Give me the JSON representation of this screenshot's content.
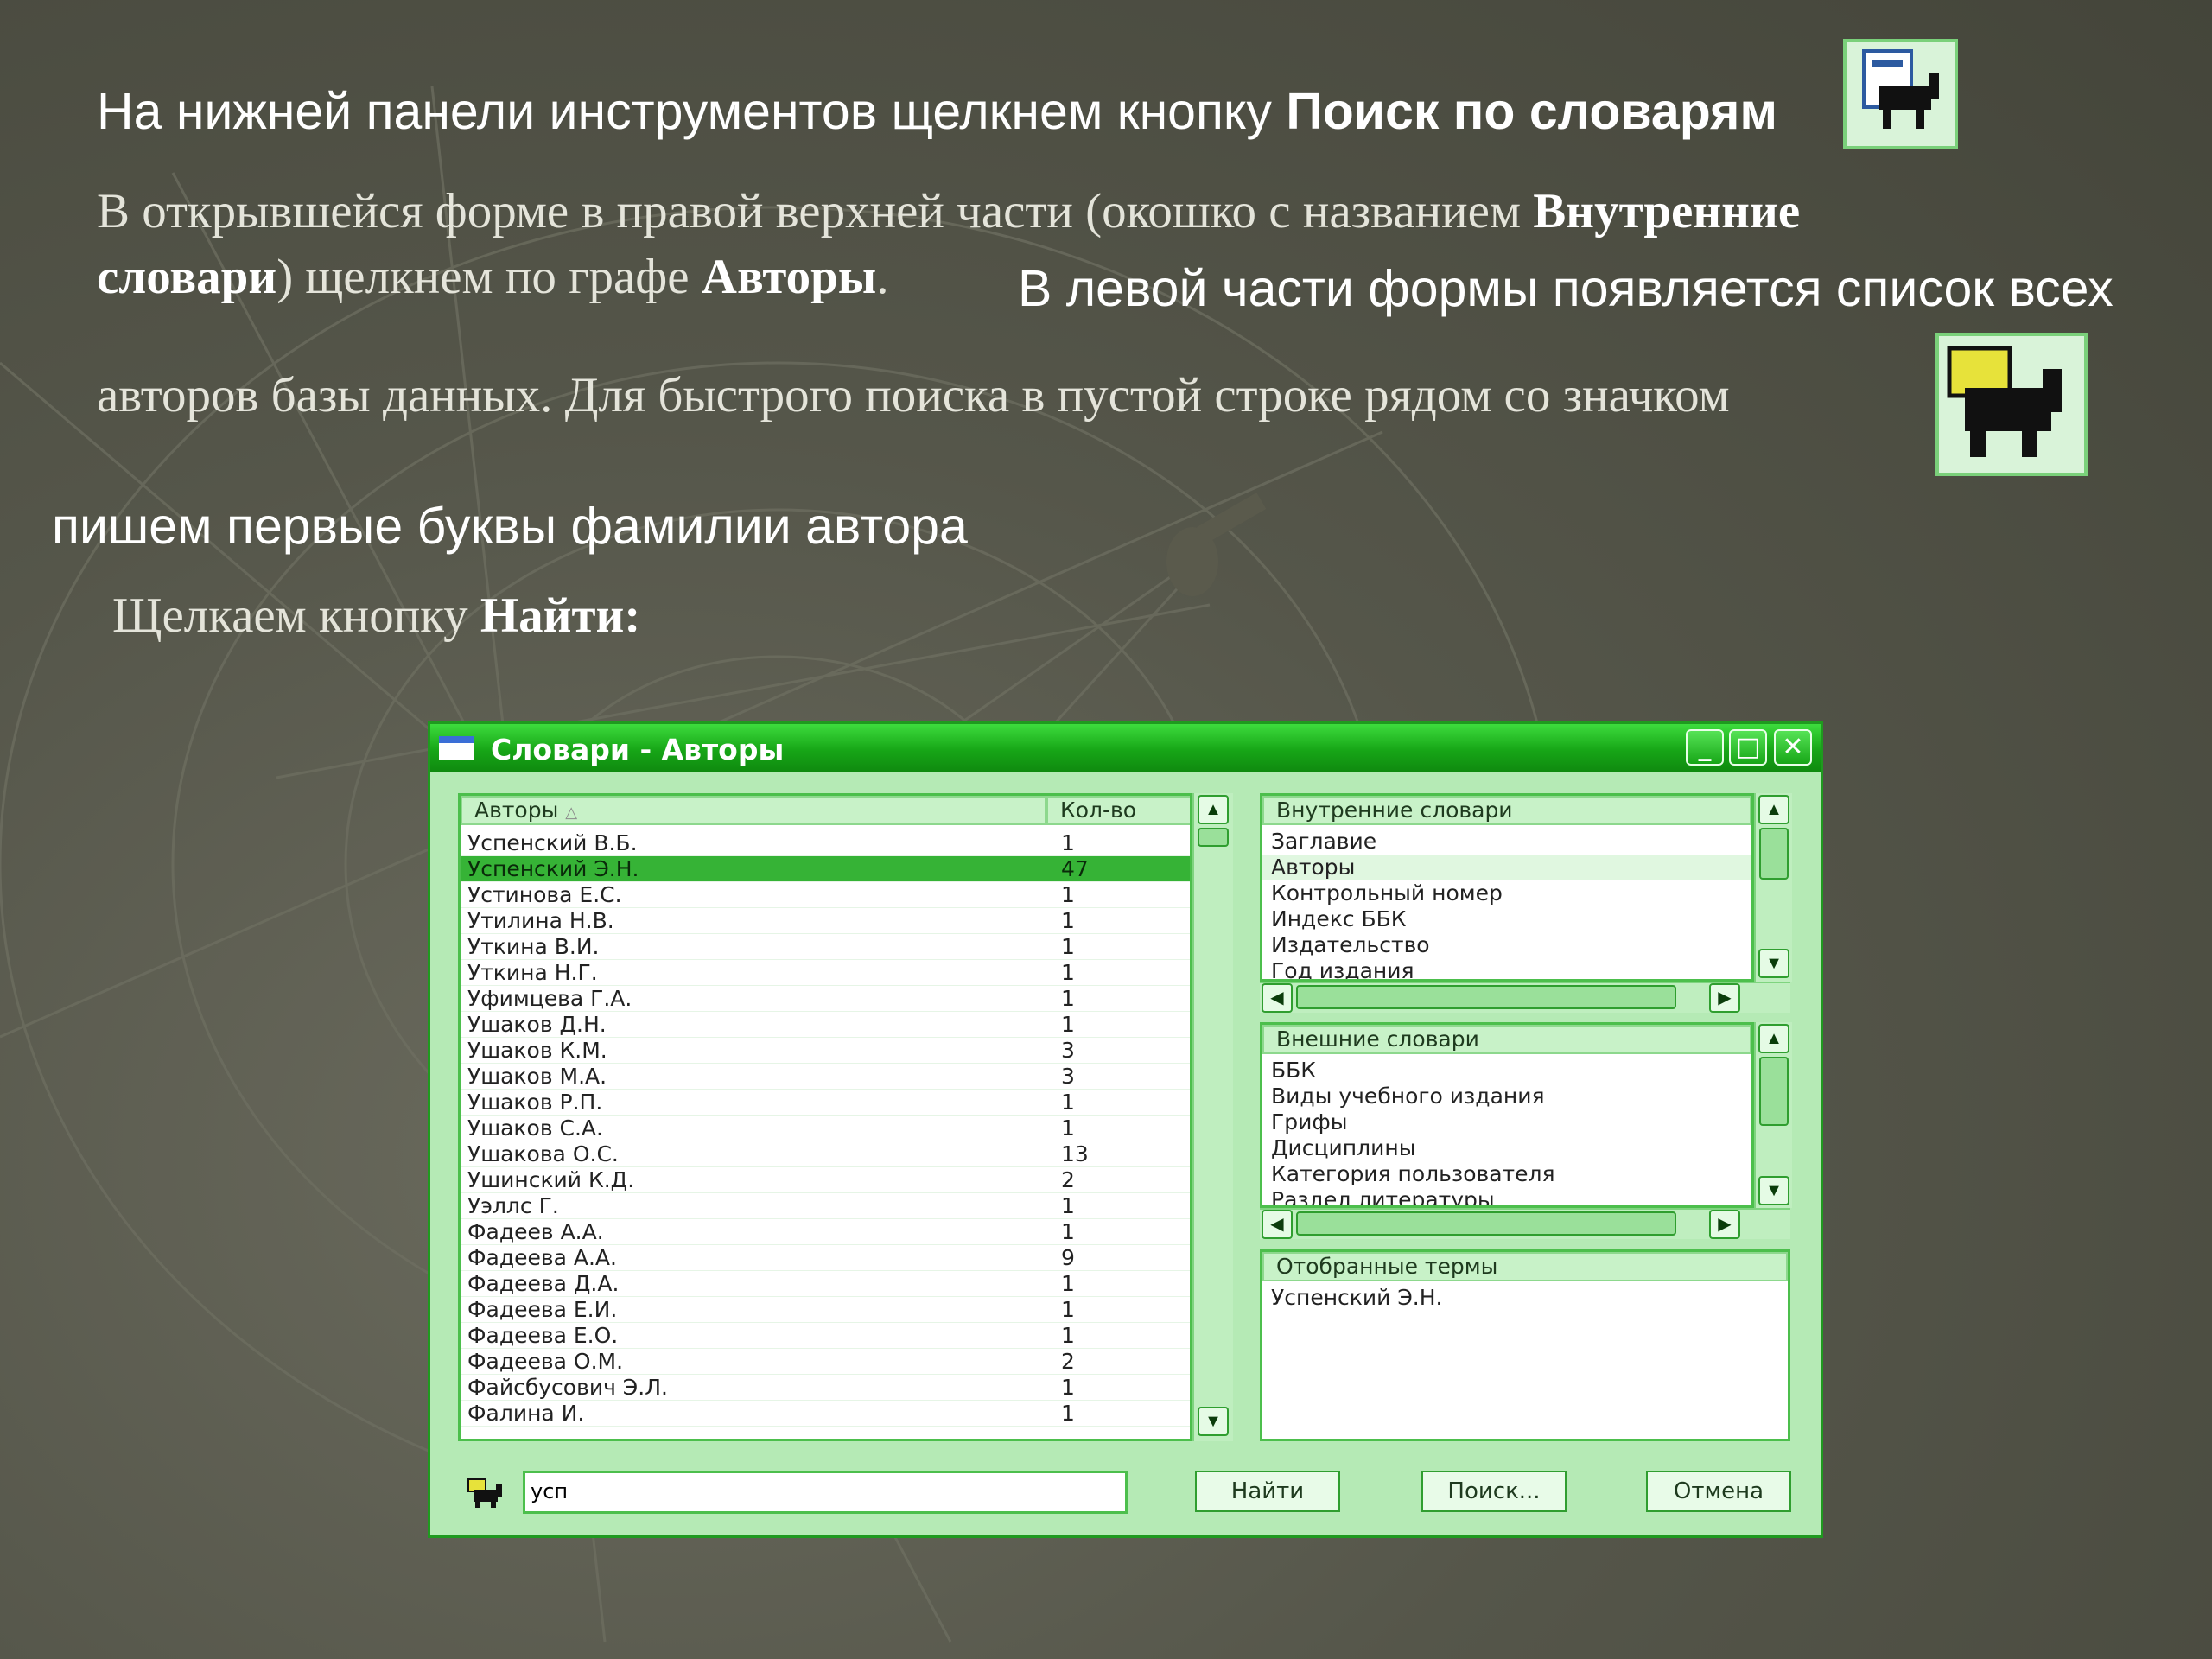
{
  "slide": {
    "line1_normal": "На нижней панели инструментов щелкнем кнопку ",
    "line1_bold": "Поиск по словарям",
    "line2_part1": "В открывшейся форме в правой верхней части (окошко с названием ",
    "line2_bold": "Внутренние",
    "line3_bold1": "словари",
    "line3_part2": ") щелкнем по графе ",
    "line3_bold2": "Авторы",
    "line3_part3": ".",
    "line3_sans": "В левой части формы появляется список всех",
    "line4": "авторов базы данных. Для быстрого поиска в пустой строке рядом со значком",
    "line5": "пишем первые буквы фамилии автора",
    "line6_normal": "Щелкаем кнопку ",
    "line6_bold": "Найти:"
  },
  "window": {
    "title": "Словари - Авторы",
    "authors_header": "Авторы",
    "count_header": "Кол-во",
    "authors": [
      {
        "name": "Успенский В.Б.",
        "count": "1"
      },
      {
        "name": "Успенский Э.Н.",
        "count": "47"
      },
      {
        "name": "Устинова Е.С.",
        "count": "1"
      },
      {
        "name": "Утилина Н.В.",
        "count": "1"
      },
      {
        "name": "Уткина В.И.",
        "count": "1"
      },
      {
        "name": "Уткина Н.Г.",
        "count": "1"
      },
      {
        "name": "Уфимцева Г.А.",
        "count": "1"
      },
      {
        "name": "Ушаков Д.Н.",
        "count": "1"
      },
      {
        "name": "Ушаков К.М.",
        "count": "3"
      },
      {
        "name": "Ушаков М.А.",
        "count": "3"
      },
      {
        "name": "Ушаков Р.П.",
        "count": "1"
      },
      {
        "name": "Ушаков С.А.",
        "count": "1"
      },
      {
        "name": "Ушакова О.С.",
        "count": "13"
      },
      {
        "name": "Ушинский К.Д.",
        "count": "2"
      },
      {
        "name": "Уэллс Г.",
        "count": "1"
      },
      {
        "name": "Фадеев А.А.",
        "count": "1"
      },
      {
        "name": "Фадеева А.А.",
        "count": "9"
      },
      {
        "name": "Фадеева Д.А.",
        "count": "1"
      },
      {
        "name": "Фадеева Е.И.",
        "count": "1"
      },
      {
        "name": "Фадеева Е.О.",
        "count": "1"
      },
      {
        "name": "Фадеева О.М.",
        "count": "2"
      },
      {
        "name": "Файсбусович Э.Л.",
        "count": "1"
      },
      {
        "name": "Фалина И.",
        "count": "1"
      }
    ],
    "selected_author_index": 1,
    "internal_header": "Внутренние словари",
    "internal_items": [
      "Заглавие",
      "Авторы",
      "Контрольный номер",
      "Индекс ББК",
      "Издательство",
      "Год издания"
    ],
    "external_header": "Внешние словари",
    "external_items": [
      "ББК",
      "Виды учебного издания",
      "Грифы",
      "Дисциплины",
      "Категория пользователя",
      "Раздел литературы"
    ],
    "selected_header": "Отобранные термы",
    "selected_items": [
      "Успенский Э.Н."
    ],
    "search_value": "усп",
    "btn_find": "Найти",
    "btn_search": "Поиск...",
    "btn_cancel": "Отмена"
  }
}
